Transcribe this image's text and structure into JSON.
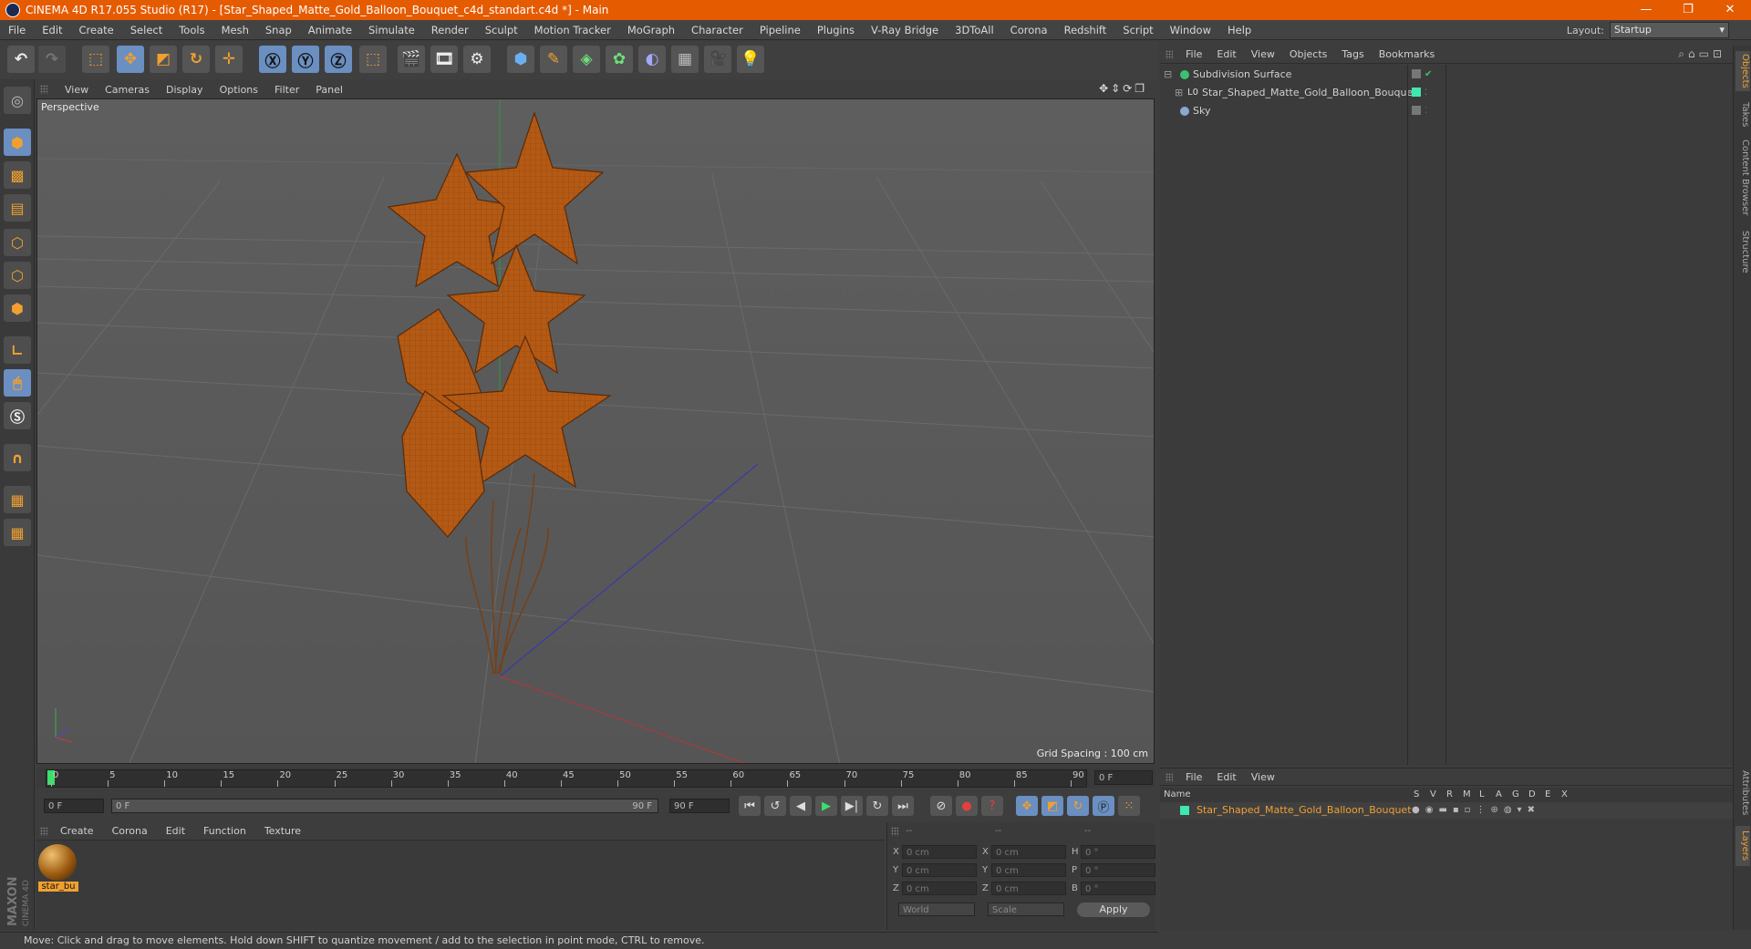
{
  "window": {
    "title": "CINEMA 4D R17.055 Studio (R17) - [Star_Shaped_Matte_Gold_Balloon_Bouquet_c4d_standart.c4d *] - Main"
  },
  "menubar": {
    "items": [
      "File",
      "Edit",
      "Create",
      "Select",
      "Tools",
      "Mesh",
      "Snap",
      "Animate",
      "Simulate",
      "Render",
      "Sculpt",
      "Motion Tracker",
      "MoGraph",
      "Character",
      "Pipeline",
      "Plugins",
      "V-Ray Bridge",
      "3DToAll",
      "Corona",
      "Redshift",
      "Script",
      "Window",
      "Help"
    ],
    "layout_label": "Layout:",
    "layout_value": "Startup"
  },
  "viewport": {
    "menu": [
      "View",
      "Cameras",
      "Display",
      "Options",
      "Filter",
      "Panel"
    ],
    "camera_label": "Perspective",
    "grid_spacing": "Grid Spacing : 100 cm"
  },
  "timeline": {
    "ticks": [
      "0",
      "5",
      "10",
      "15",
      "20",
      "25",
      "30",
      "35",
      "40",
      "45",
      "50",
      "55",
      "60",
      "65",
      "70",
      "75",
      "80",
      "85",
      "90"
    ],
    "current_frame": "0 F",
    "start_field": "0 F",
    "slider_start": "0 F",
    "slider_end": "90 F",
    "end_field": "90 F"
  },
  "material_manager": {
    "menu": [
      "Create",
      "Corona",
      "Edit",
      "Function",
      "Texture"
    ],
    "materials": [
      {
        "name": "star_bu"
      }
    ]
  },
  "coordinates": {
    "headers": [
      "--",
      "--",
      "--"
    ],
    "rows": [
      {
        "a_label": "X",
        "a_val": "0 cm",
        "b_label": "X",
        "b_val": "0 cm",
        "c_label": "H",
        "c_val": "0 °"
      },
      {
        "a_label": "Y",
        "a_val": "0 cm",
        "b_label": "Y",
        "b_val": "0 cm",
        "c_label": "P",
        "c_val": "0 °"
      },
      {
        "a_label": "Z",
        "a_val": "0 cm",
        "b_label": "Z",
        "b_val": "0 cm",
        "c_label": "B",
        "c_val": "0 °"
      }
    ],
    "mode_world": "World",
    "mode_scale": "Scale",
    "apply_label": "Apply"
  },
  "status_bar": {
    "text": "Move: Click and drag to move elements. Hold down SHIFT to quantize movement / add to the selection in point mode, CTRL to remove."
  },
  "object_manager": {
    "menu": [
      "File",
      "Edit",
      "View",
      "Objects",
      "Tags",
      "Bookmarks"
    ],
    "objects": [
      {
        "name": "Subdivision Surface"
      },
      {
        "name": "Star_Shaped_Matte_Gold_Balloon_Bouquet"
      },
      {
        "name": "Sky"
      }
    ]
  },
  "side_tabs": [
    "Objects",
    "Takes",
    "Content Browser",
    "Structure"
  ],
  "side_tabs_lower": [
    "Attributes",
    "Layers"
  ],
  "layer_manager": {
    "menu": [
      "File",
      "Edit",
      "View"
    ],
    "header_name": "Name",
    "header_cols": [
      "S",
      "V",
      "R",
      "M",
      "L",
      "A",
      "G",
      "D",
      "E",
      "X"
    ],
    "layer_name": "Star_Shaped_Matte_Gold_Balloon_Bouquet"
  },
  "colors": {
    "accent": "#e55b00",
    "selection_orange": "#f0a030",
    "balloon": "#b45a14",
    "layer_green": "#3ee8b0"
  }
}
